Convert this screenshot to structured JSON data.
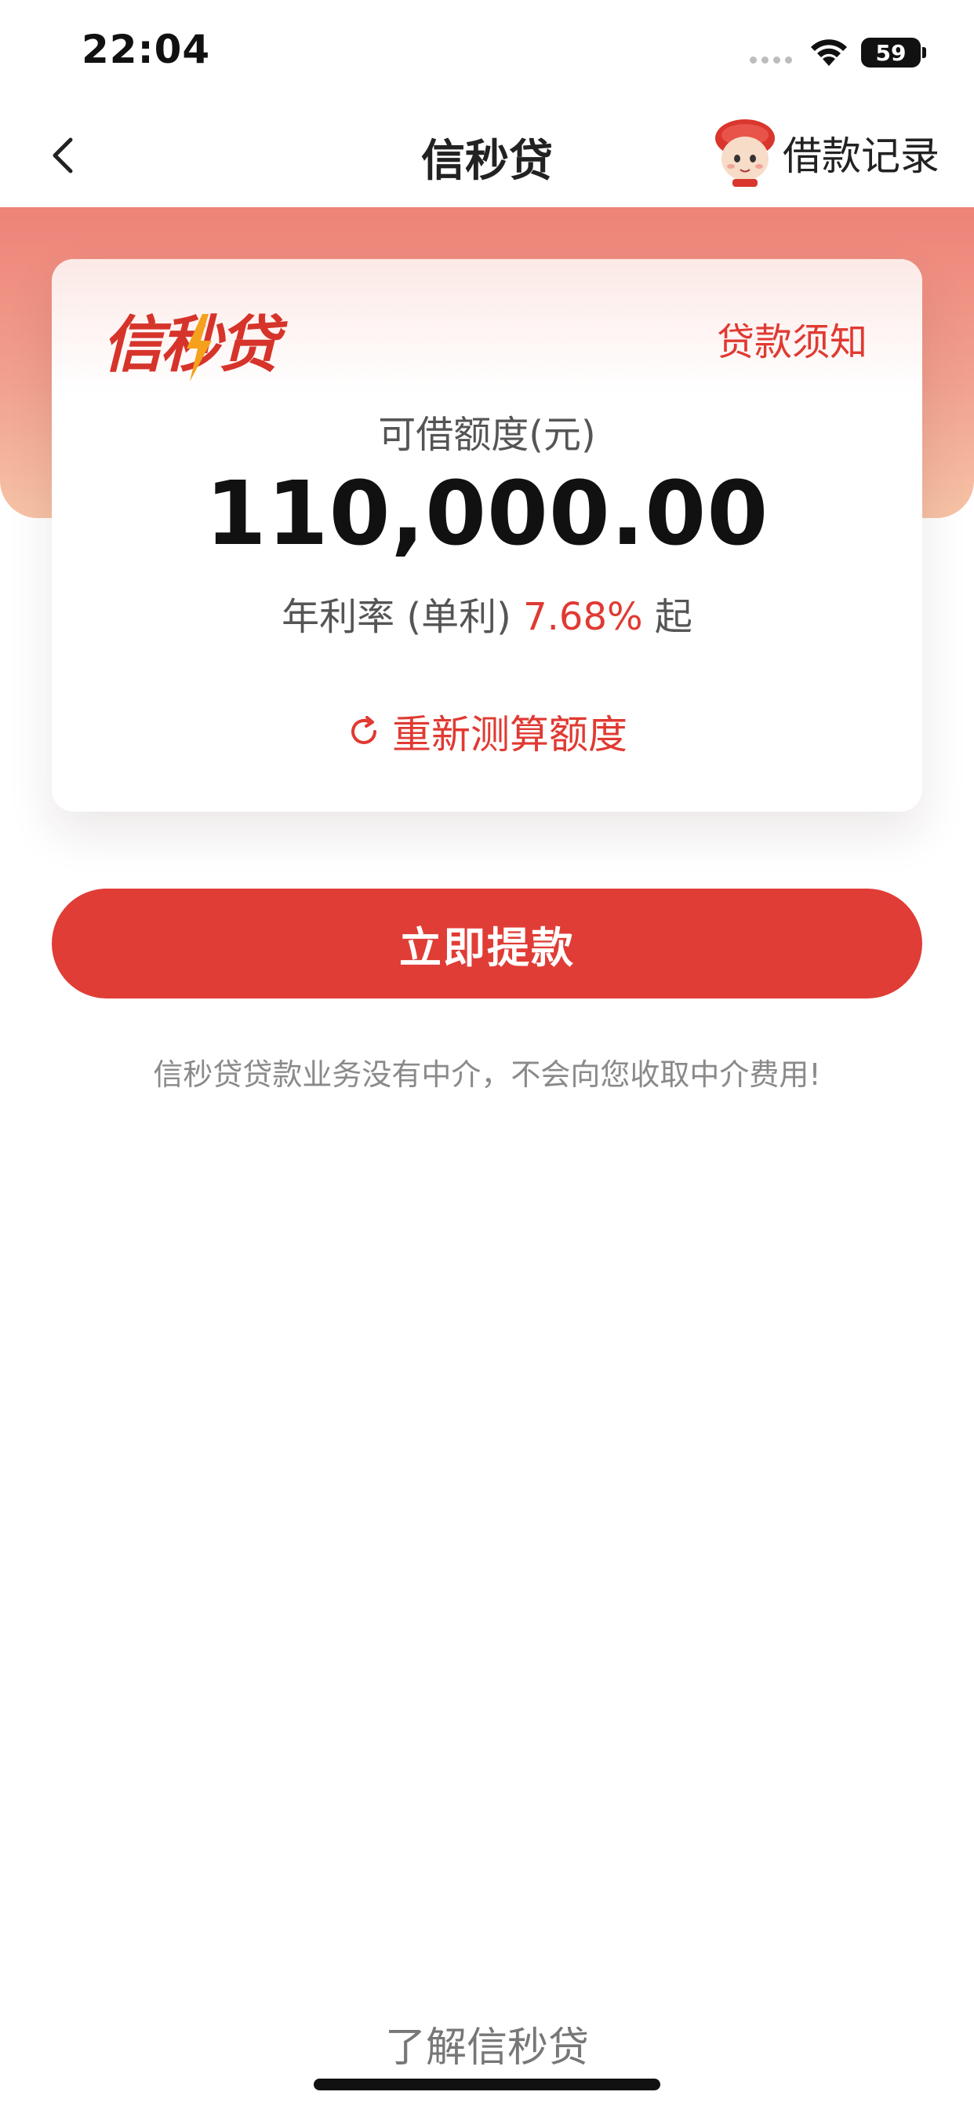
{
  "status_bar": {
    "time": "22:04",
    "battery": "59"
  },
  "nav": {
    "title": "信秒贷",
    "loan_records_label": "借款记录"
  },
  "card": {
    "brand_logo_text": "信秒贷",
    "loan_notice_label": "贷款须知",
    "limit_label": "可借额度(元)",
    "limit_amount": "110,000.00",
    "rate_prefix": "年利率 (单利) ",
    "rate_value": "7.68%",
    "rate_suffix": " 起",
    "recalc_label": "重新测算额度"
  },
  "withdraw_button_label": "立即提款",
  "disclaimer": "信秒贷贷款业务没有中介，不会向您收取中介费用!",
  "learn_more_label": "了解信秒贷",
  "colors": {
    "accent": "#e03d36",
    "header_gradient_top": "#ee8378",
    "header_gradient_bottom": "#f6c3a6",
    "logo_orange": "#f5a11d"
  }
}
